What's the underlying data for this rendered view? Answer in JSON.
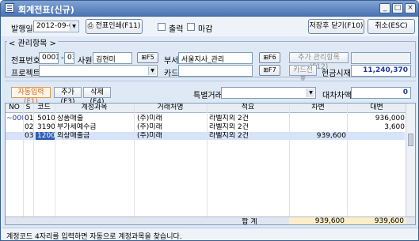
{
  "window": {
    "title": "회계전표(신규)",
    "accent": "#4b74b2"
  },
  "toolbar": {
    "date_label": "발행일",
    "date_value": "2012-09-03",
    "print_button": "전표인쇄(F11)",
    "print_check": "출력",
    "close_check": "마감",
    "save_close_button": "저장후 닫기(F10)",
    "cancel_button": "취소(ESC)"
  },
  "section": {
    "title": "< 관리항목 >",
    "voucher_no_label": "전표번호",
    "voucher_no_a": "0001",
    "voucher_dash": "-",
    "voucher_no_b": "03",
    "employee_label": "사원",
    "employee_value": "김현미",
    "f5": "F5",
    "dept_label": "부서",
    "dept_value": "서울지사_관리",
    "f6": "F6",
    "add_items_button": "추가 관리항목(F12)",
    "project_label": "프로젝트",
    "card_label": "카드",
    "f7": "F7",
    "card_voucher_button": "카드전표",
    "cash_balance_label": "현금시재",
    "cash_balance_value": "11,240,370"
  },
  "actions": {
    "auto_input": "자동입력(F1)",
    "add": "추가(F3)",
    "delete": "삭제(F4)",
    "special_label": "특별거래",
    "balance_label": "대차차액",
    "balance_value": "0"
  },
  "table": {
    "headers": [
      "NO",
      "S",
      "코드",
      "계정과목",
      "거래처명",
      "적요",
      "차변",
      "대변"
    ],
    "rows": [
      {
        "no": "~0001",
        "s": "01",
        "code": "5010",
        "account": "상품매출",
        "client": "(주)미래",
        "memo": "라벨지외 2건",
        "debit": "",
        "credit": "936,000"
      },
      {
        "no": "",
        "s": "02",
        "code": "3190",
        "account": "부가세예수금",
        "client": "(주)미래",
        "memo": "라벨지외 2건",
        "debit": "",
        "credit": "3,600"
      },
      {
        "no": "",
        "s": "03",
        "code": "1200",
        "account": "외상매출금",
        "client": "(주)미래",
        "memo": "라벨지외 2건",
        "debit": "939,600",
        "credit": ""
      }
    ],
    "total_label": "합  계",
    "total_debit": "939,600",
    "total_credit": "939,600"
  },
  "status": {
    "message": "계정코드 4자리를 입력하면 자동으로 계정과목을 찾습니다."
  }
}
